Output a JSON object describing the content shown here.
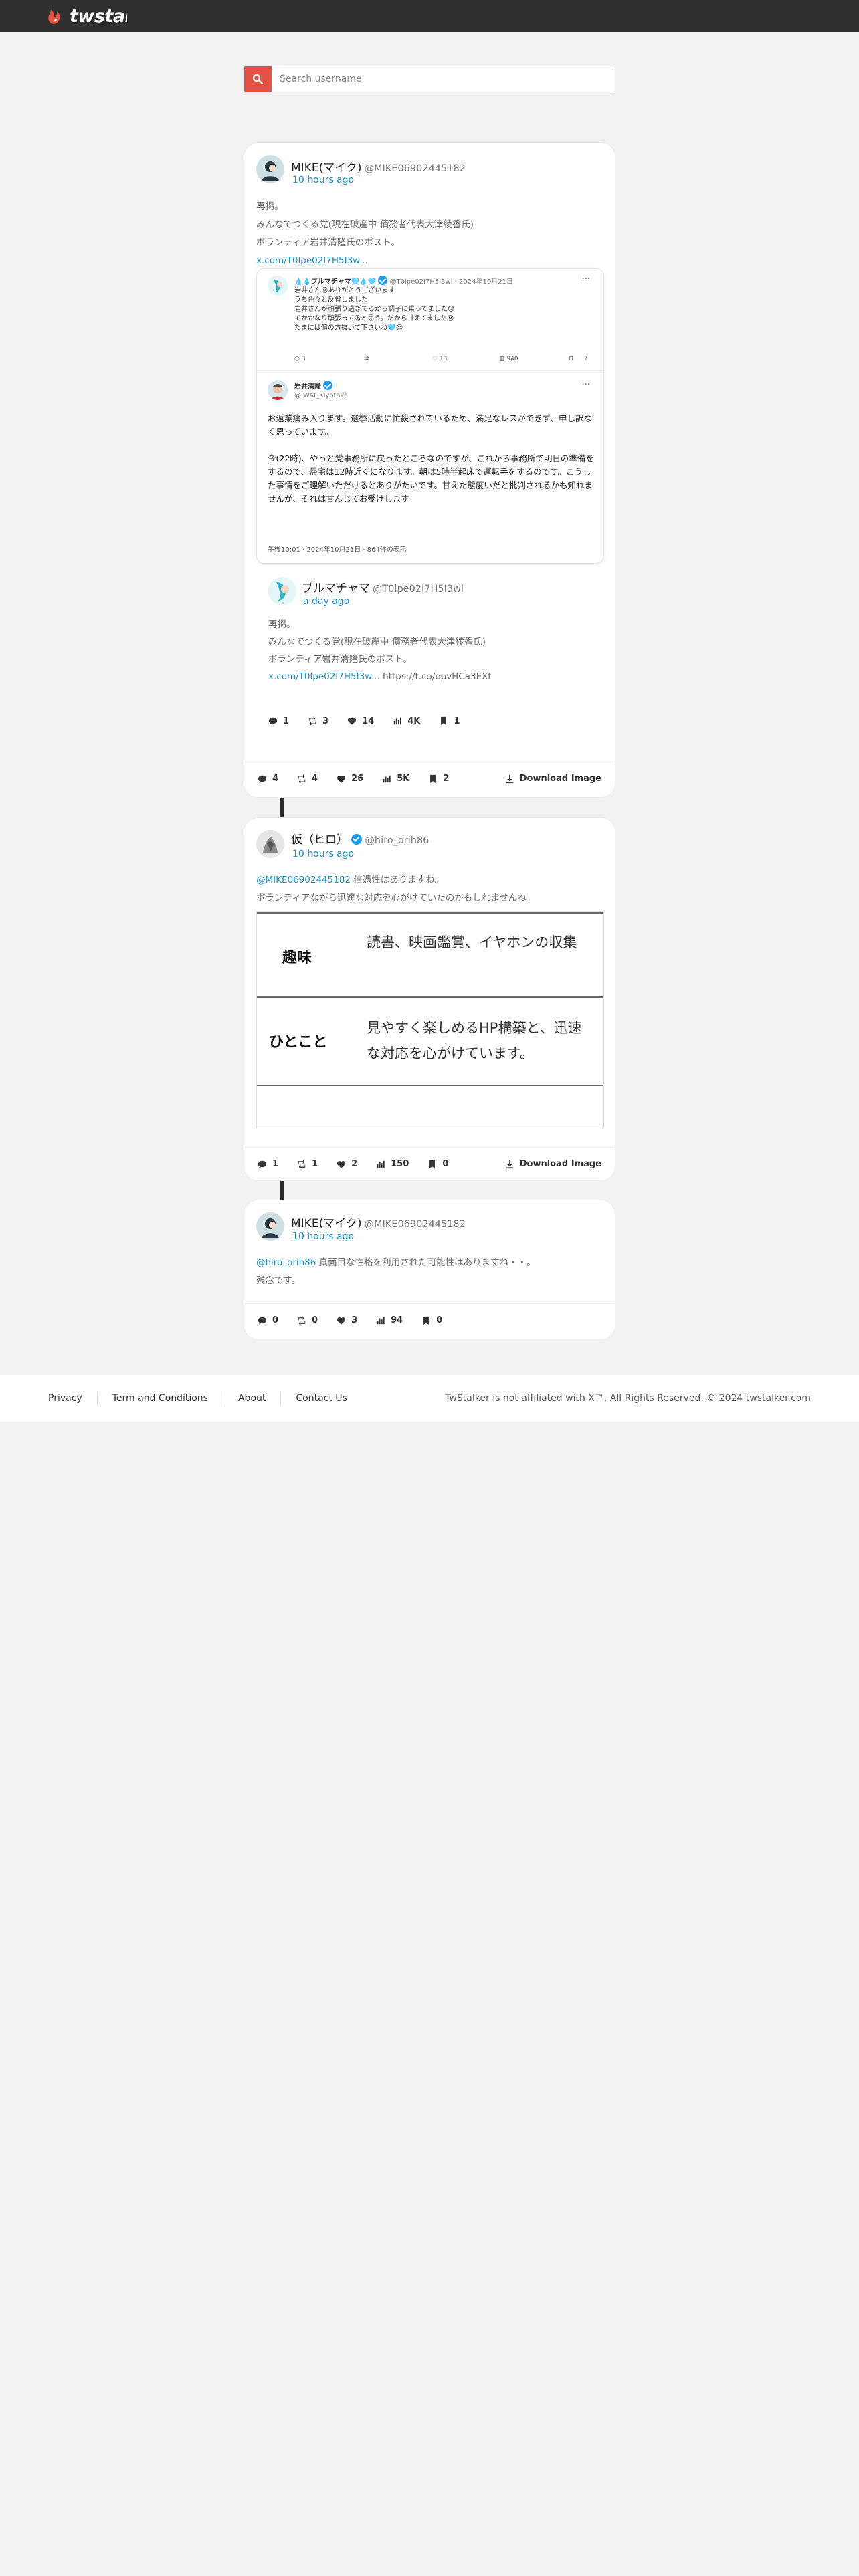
{
  "brand": {
    "name": "twstal"
  },
  "search": {
    "placeholder": "Search username"
  },
  "post1": {
    "name": "MIKE(マイク)",
    "handle": "@MIKE06902445182",
    "time": "10 hours ago",
    "lines": [
      "再掲。",
      "みんなでつくる党(現在破産中 債務者代表大津綾香氏)",
      "ボランティア岩井清隆氏のポスト。"
    ],
    "link": "x.com/T0lpe02I7H5I3w...",
    "embed": {
      "name": "💧💧ブルマチャマ🩵💧🩵",
      "handle": "@T0lpe02I7H5I3wl · 2024年10月21日",
      "lines": [
        "岩井さん😢ありがとうございます",
        "うち色々と反省しました",
        "岩井さんが頑張り過ぎてるから調子に乗ってました😓",
        "てかかなり頑張ってると思う。だから甘えてました😓",
        "たまには偏の方抜いて下さいね🩵😉"
      ],
      "stats": [
        "3",
        "",
        "13",
        "940"
      ],
      "reply_name": "岩井清隆",
      "reply_handle": "@IWAI_Kiyotaka",
      "reply_p1": "お返業痛み入ります。選挙活動に忙殺されているため、満足なレスができず、申し訳なく思っています。",
      "reply_p2": "今(22時)、やっと党事務所に戻ったところなのですが、これから事務所で明日の準備をするので、帰宅は12時近くになります。朝は5時半起床で運転手をするのです。こうした事情をご理解いただけるとありがたいです。甘えた態度いだと批判されるかも知れませんが、それは甘んじてお受けします。",
      "footer": "午後10:01 · 2024年10月21日 · 864件の表示"
    },
    "inner": {
      "name": "ブルマチャマ",
      "handle": "@T0lpe02I7H5I3wl",
      "time": "a day ago",
      "lines": [
        "再掲。",
        "みんなでつくる党(現在破産中 債務者代表大津綾香氏)",
        "ボランティア岩井清隆氏のポスト。"
      ],
      "link": "x.com/T0lpe02I7H5I3w...",
      "tco": "https://t.co/opvHCa3EXt",
      "stats": {
        "replies": "1",
        "retweets": "3",
        "likes": "14",
        "views": "4K",
        "bookmarks": "1"
      }
    },
    "stats": {
      "replies": "4",
      "retweets": "4",
      "likes": "26",
      "views": "5K",
      "bookmarks": "2"
    },
    "download": "Download Image"
  },
  "post2": {
    "name": "仮（ヒロ）",
    "handle": "@hiro_orih86",
    "time": "10 hours ago",
    "mention": "@MIKE06902445182",
    "text1": " 信憑性はありますね。",
    "text2": "ボランティアながら迅速な対応を心がけていたのかもしれませんね。",
    "table": [
      {
        "key": "趣味",
        "value": "読書、映画鑑賞、イヤホンの収集"
      },
      {
        "key": "ひとこと",
        "value": "見やすく楽しめるHP構築と、迅速な対応を心がけています。"
      }
    ],
    "stats": {
      "replies": "1",
      "retweets": "1",
      "likes": "2",
      "views": "150",
      "bookmarks": "0"
    },
    "download": "Download Image"
  },
  "post3": {
    "name": "MIKE(マイク)",
    "handle": "@MIKE06902445182",
    "time": "10 hours ago",
    "mention": "@hiro_orih86",
    "text1": " 真面目な性格を利用された可能性はありますね・・。",
    "text2": "残念です。",
    "stats": {
      "replies": "0",
      "retweets": "0",
      "likes": "3",
      "views": "94",
      "bookmarks": "0"
    }
  },
  "footer": {
    "links": [
      "Privacy",
      "Term and Conditions",
      "About",
      "Contact Us"
    ],
    "copyright": "TwStalker is not affiliated with X™. All Rights Reserved. © 2024 twstalker.com"
  },
  "colors": {
    "accent": "#e25142",
    "link": "#1c8ec4",
    "topbar": "#2f2f2f",
    "verified": "#1d9bf0"
  },
  "icons": [
    "search-icon",
    "reply-icon",
    "retweet-icon",
    "like-icon",
    "views-icon",
    "bookmark-icon",
    "download-icon",
    "more-icon",
    "share-icon"
  ]
}
